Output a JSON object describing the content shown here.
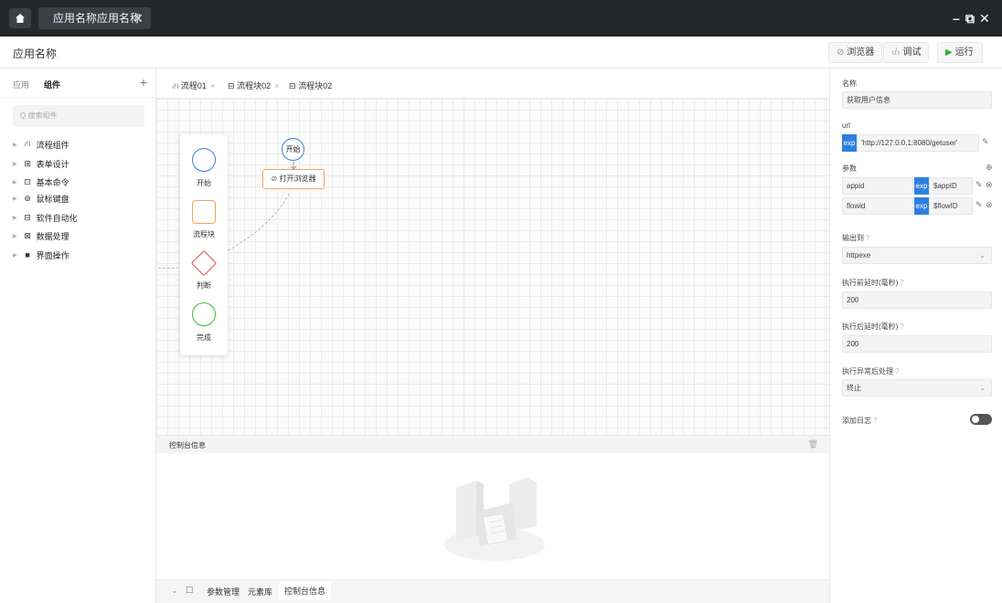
{
  "titlebar": {
    "tab_label": "应用名称应用名称",
    "tab_close": "✕",
    "minimize": "–",
    "restore": "⧉",
    "close": "✕"
  },
  "header": {
    "app_name": "应用名称",
    "browser_label": "浏览器",
    "debug_label": "调试",
    "run_label": "运行",
    "run_color": "#2fb12f"
  },
  "sidebar": {
    "tab_app": "应用",
    "tab_component": "组件",
    "add": "+",
    "search_placeholder": "Q 搜索组件",
    "items": [
      {
        "label": "流程组件",
        "icon": "flow-icon"
      },
      {
        "label": "表单设计",
        "icon": "table-icon"
      },
      {
        "label": "基本命令",
        "icon": "command-icon"
      },
      {
        "label": "鼠标键盘",
        "icon": "mouse-keyboard-icon"
      },
      {
        "label": "软件自动化",
        "icon": "automation-icon"
      },
      {
        "label": "数据处理",
        "icon": "data-icon"
      },
      {
        "label": "界面操作",
        "icon": "ui-icon"
      }
    ]
  },
  "editor": {
    "tabs": [
      {
        "label": "流程01",
        "closable": true
      },
      {
        "label": "流程块02",
        "closable": true
      },
      {
        "label": "流程块02",
        "closable": false
      }
    ],
    "palette": [
      {
        "label": "开始",
        "shape": "circle",
        "color": "#3b7ddd"
      },
      {
        "label": "流程块",
        "shape": "rounded-square",
        "color": "#f0a55a"
      },
      {
        "label": "判断",
        "shape": "diamond",
        "color": "#e84a4a"
      },
      {
        "label": "完成",
        "shape": "circle",
        "color": "#3cb83c"
      }
    ],
    "nodes": {
      "start": "开始",
      "browser": "打开浏览器"
    }
  },
  "console": {
    "title": "控制台信息",
    "bottom_tabs": [
      "参数管理",
      "元素库",
      "控制台信息"
    ]
  },
  "props": {
    "name_label": "名称",
    "name_value": "获取用户信息",
    "url_label": "url",
    "url_value": "'http://127.0.0.1:8080/getuser'",
    "exp": "exp",
    "params_label": "参数",
    "params": [
      {
        "key": "appid",
        "value": "$appID"
      },
      {
        "key": "flowid",
        "value": "$flowID"
      }
    ],
    "output_label": "输出到",
    "output_value": "httpexe",
    "pre_delay_label": "执行前延时(毫秒)",
    "pre_delay_value": "200",
    "post_delay_label": "执行后延时(毫秒)",
    "post_delay_value": "200",
    "error_label": "执行异常后处理",
    "error_value": "终止",
    "log_label": "添加日志",
    "log_enabled": false
  }
}
